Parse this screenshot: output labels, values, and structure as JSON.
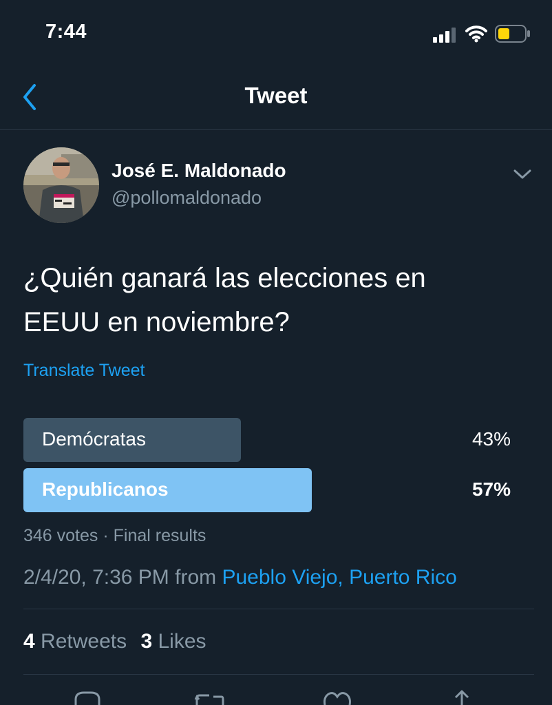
{
  "status_bar": {
    "time": "7:44"
  },
  "nav": {
    "title": "Tweet"
  },
  "tweet": {
    "author_name": "José E. Maldonado",
    "author_handle": "@pollomaldonado",
    "text_line1": "¿Quién ganará las elecciones en",
    "text_line2": "EEUU en noviembre?",
    "translate_label": "Translate Tweet",
    "poll": {
      "options": [
        {
          "label": "Demócratas",
          "percent_text": "43%",
          "percent": 43,
          "winner": false
        },
        {
          "label": "Republicanos",
          "percent_text": "57%",
          "percent": 57,
          "winner": true
        }
      ],
      "meta": "346 votes · Final results"
    },
    "timestamp": "2/4/20, 7:36 PM from",
    "location": "Pueblo Viejo, Puerto Rico",
    "stats": {
      "retweets_count": "4",
      "retweets_label": "Retweets",
      "likes_count": "3",
      "likes_label": "Likes"
    }
  },
  "colors": {
    "background": "#15202b",
    "accent": "#1da1f2",
    "secondary_text": "#8899a6",
    "poll_winner": "#7fc3f4",
    "poll_loser": "#3d5466"
  },
  "icons": [
    "back-chevron-icon",
    "chevron-down-icon",
    "reply-icon",
    "retweet-icon",
    "like-icon",
    "share-icon"
  ]
}
